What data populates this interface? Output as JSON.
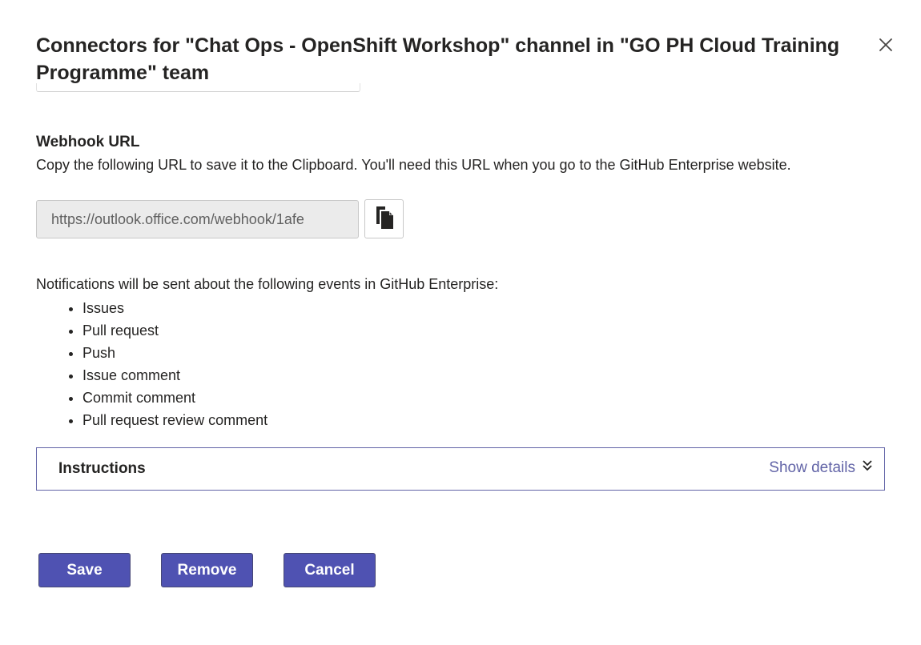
{
  "dialog": {
    "title": "Connectors for \"Chat Ops - OpenShift Workshop\" channel in \"GO PH Cloud Training Programme\" team",
    "close_icon": "close-icon"
  },
  "webhook": {
    "heading": "Webhook URL",
    "description": "Copy the following URL to save it to the Clipboard. You'll need this URL when you go to the GitHub Enterprise website.",
    "url_value": "https://outlook.office.com/webhook/1afe",
    "copy_icon": "copy-icon"
  },
  "notifications": {
    "intro": "Notifications will be sent about the following events in GitHub Enterprise:",
    "events": [
      "Issues",
      "Pull request",
      "Push",
      "Issue comment",
      "Commit comment",
      "Pull request review comment"
    ]
  },
  "instructions": {
    "title": "Instructions",
    "toggle_label": "Show details",
    "toggle_icon": "double-chevron-down-icon"
  },
  "footer": {
    "save_label": "Save",
    "remove_label": "Remove",
    "cancel_label": "Cancel"
  },
  "colors": {
    "brand": "#6264a7",
    "button_bg": "#4f52b2",
    "text": "#252423",
    "field_bg": "#ebebeb"
  }
}
